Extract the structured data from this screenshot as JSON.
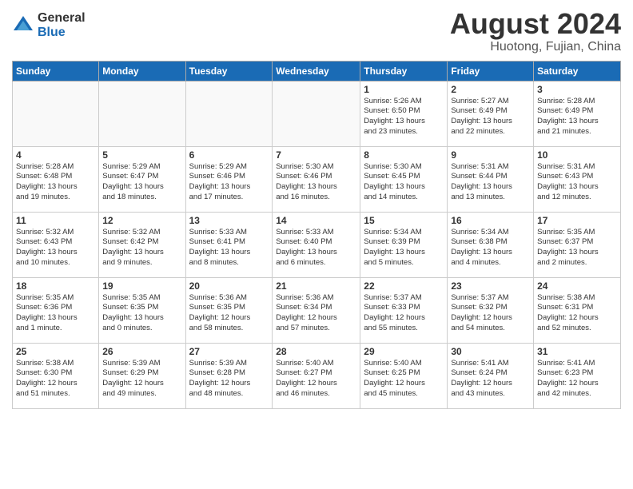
{
  "header": {
    "logo": {
      "general": "General",
      "blue": "Blue"
    },
    "title": "August 2024",
    "location": "Huotong, Fujian, China"
  },
  "calendar": {
    "headers": [
      "Sunday",
      "Monday",
      "Tuesday",
      "Wednesday",
      "Thursday",
      "Friday",
      "Saturday"
    ],
    "weeks": [
      [
        {
          "day": "",
          "content": ""
        },
        {
          "day": "",
          "content": ""
        },
        {
          "day": "",
          "content": ""
        },
        {
          "day": "",
          "content": ""
        },
        {
          "day": "1",
          "content": "Sunrise: 5:26 AM\nSunset: 6:50 PM\nDaylight: 13 hours\nand 23 minutes."
        },
        {
          "day": "2",
          "content": "Sunrise: 5:27 AM\nSunset: 6:49 PM\nDaylight: 13 hours\nand 22 minutes."
        },
        {
          "day": "3",
          "content": "Sunrise: 5:28 AM\nSunset: 6:49 PM\nDaylight: 13 hours\nand 21 minutes."
        }
      ],
      [
        {
          "day": "4",
          "content": "Sunrise: 5:28 AM\nSunset: 6:48 PM\nDaylight: 13 hours\nand 19 minutes."
        },
        {
          "day": "5",
          "content": "Sunrise: 5:29 AM\nSunset: 6:47 PM\nDaylight: 13 hours\nand 18 minutes."
        },
        {
          "day": "6",
          "content": "Sunrise: 5:29 AM\nSunset: 6:46 PM\nDaylight: 13 hours\nand 17 minutes."
        },
        {
          "day": "7",
          "content": "Sunrise: 5:30 AM\nSunset: 6:46 PM\nDaylight: 13 hours\nand 16 minutes."
        },
        {
          "day": "8",
          "content": "Sunrise: 5:30 AM\nSunset: 6:45 PM\nDaylight: 13 hours\nand 14 minutes."
        },
        {
          "day": "9",
          "content": "Sunrise: 5:31 AM\nSunset: 6:44 PM\nDaylight: 13 hours\nand 13 minutes."
        },
        {
          "day": "10",
          "content": "Sunrise: 5:31 AM\nSunset: 6:43 PM\nDaylight: 13 hours\nand 12 minutes."
        }
      ],
      [
        {
          "day": "11",
          "content": "Sunrise: 5:32 AM\nSunset: 6:43 PM\nDaylight: 13 hours\nand 10 minutes."
        },
        {
          "day": "12",
          "content": "Sunrise: 5:32 AM\nSunset: 6:42 PM\nDaylight: 13 hours\nand 9 minutes."
        },
        {
          "day": "13",
          "content": "Sunrise: 5:33 AM\nSunset: 6:41 PM\nDaylight: 13 hours\nand 8 minutes."
        },
        {
          "day": "14",
          "content": "Sunrise: 5:33 AM\nSunset: 6:40 PM\nDaylight: 13 hours\nand 6 minutes."
        },
        {
          "day": "15",
          "content": "Sunrise: 5:34 AM\nSunset: 6:39 PM\nDaylight: 13 hours\nand 5 minutes."
        },
        {
          "day": "16",
          "content": "Sunrise: 5:34 AM\nSunset: 6:38 PM\nDaylight: 13 hours\nand 4 minutes."
        },
        {
          "day": "17",
          "content": "Sunrise: 5:35 AM\nSunset: 6:37 PM\nDaylight: 13 hours\nand 2 minutes."
        }
      ],
      [
        {
          "day": "18",
          "content": "Sunrise: 5:35 AM\nSunset: 6:36 PM\nDaylight: 13 hours\nand 1 minute."
        },
        {
          "day": "19",
          "content": "Sunrise: 5:35 AM\nSunset: 6:35 PM\nDaylight: 13 hours\nand 0 minutes."
        },
        {
          "day": "20",
          "content": "Sunrise: 5:36 AM\nSunset: 6:35 PM\nDaylight: 12 hours\nand 58 minutes."
        },
        {
          "day": "21",
          "content": "Sunrise: 5:36 AM\nSunset: 6:34 PM\nDaylight: 12 hours\nand 57 minutes."
        },
        {
          "day": "22",
          "content": "Sunrise: 5:37 AM\nSunset: 6:33 PM\nDaylight: 12 hours\nand 55 minutes."
        },
        {
          "day": "23",
          "content": "Sunrise: 5:37 AM\nSunset: 6:32 PM\nDaylight: 12 hours\nand 54 minutes."
        },
        {
          "day": "24",
          "content": "Sunrise: 5:38 AM\nSunset: 6:31 PM\nDaylight: 12 hours\nand 52 minutes."
        }
      ],
      [
        {
          "day": "25",
          "content": "Sunrise: 5:38 AM\nSunset: 6:30 PM\nDaylight: 12 hours\nand 51 minutes."
        },
        {
          "day": "26",
          "content": "Sunrise: 5:39 AM\nSunset: 6:29 PM\nDaylight: 12 hours\nand 49 minutes."
        },
        {
          "day": "27",
          "content": "Sunrise: 5:39 AM\nSunset: 6:28 PM\nDaylight: 12 hours\nand 48 minutes."
        },
        {
          "day": "28",
          "content": "Sunrise: 5:40 AM\nSunset: 6:27 PM\nDaylight: 12 hours\nand 46 minutes."
        },
        {
          "day": "29",
          "content": "Sunrise: 5:40 AM\nSunset: 6:25 PM\nDaylight: 12 hours\nand 45 minutes."
        },
        {
          "day": "30",
          "content": "Sunrise: 5:41 AM\nSunset: 6:24 PM\nDaylight: 12 hours\nand 43 minutes."
        },
        {
          "day": "31",
          "content": "Sunrise: 5:41 AM\nSunset: 6:23 PM\nDaylight: 12 hours\nand 42 minutes."
        }
      ]
    ]
  }
}
